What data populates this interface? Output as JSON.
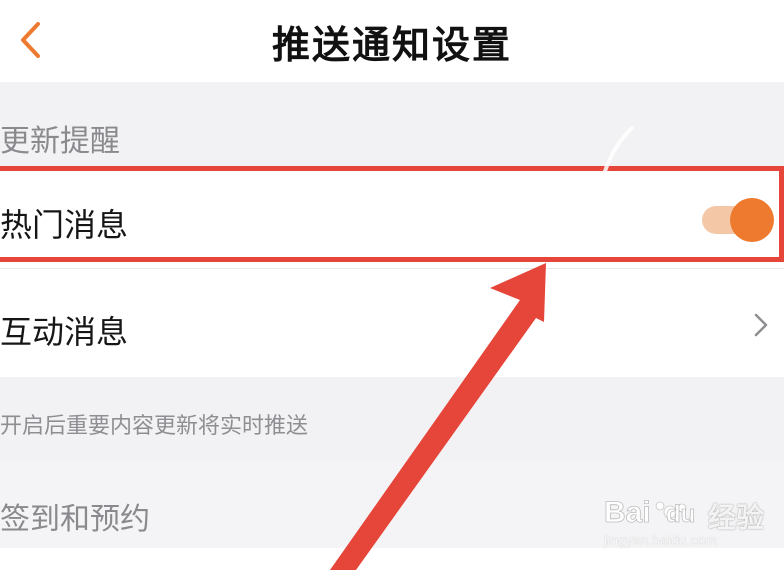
{
  "header": {
    "title": "推送通知设置",
    "back_icon": "chevron-left-icon",
    "accent_color": "#ee7a2f"
  },
  "sections": {
    "update_reminders": {
      "label": "更新提醒",
      "rows": [
        {
          "label": "热门消息",
          "control": "toggle",
          "toggle_on": true
        },
        {
          "label": "互动消息",
          "control": "chevron-right-icon"
        }
      ],
      "footnote": "开启后重要内容更新将实时推送"
    },
    "checkin": {
      "label": "签到和预约"
    }
  },
  "annotation": {
    "highlight_color": "#e6453a"
  },
  "watermark": {
    "brand_text": "经验",
    "url_text": "jingyan.baidu.com",
    "logo_text": "Baidu"
  }
}
